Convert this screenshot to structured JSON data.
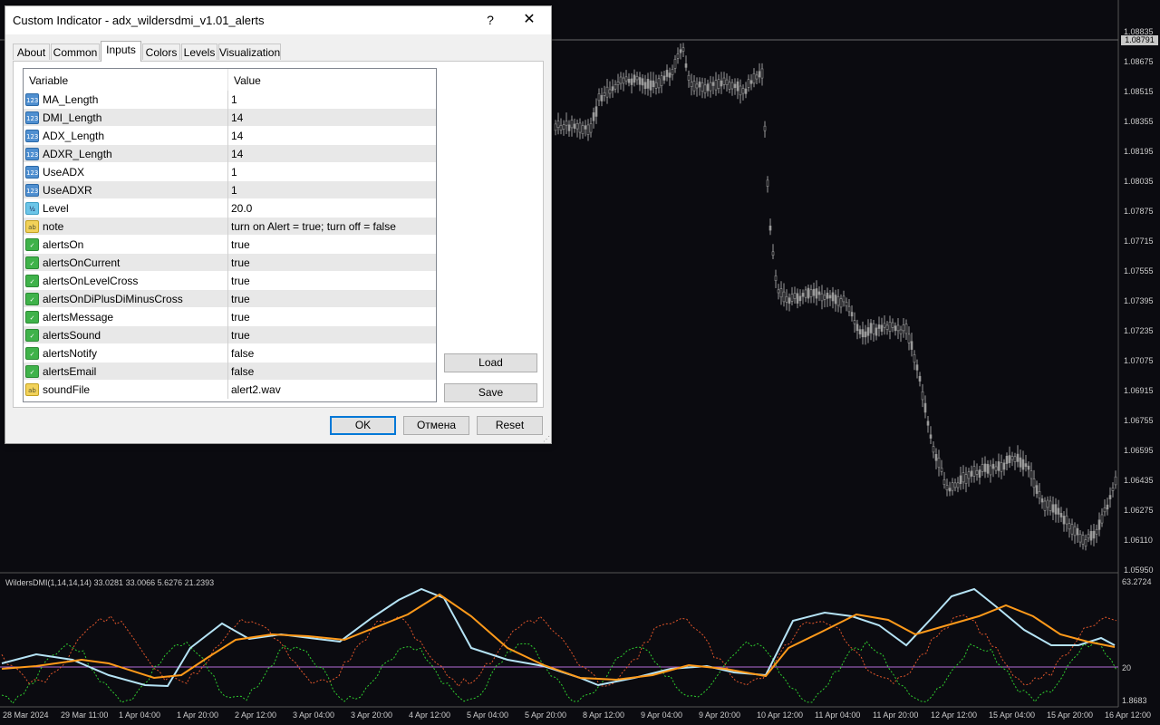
{
  "dialog": {
    "title": "Custom Indicator - adx_wildersdmi_v1.01_alerts",
    "help_glyph": "?",
    "close_glyph": "✕",
    "tabs": [
      "About",
      "Common",
      "Inputs",
      "Colors",
      "Levels",
      "Visualization"
    ],
    "active_tab": "Inputs",
    "grid": {
      "col_variable": "Variable",
      "col_value": "Value",
      "rows": [
        {
          "type": "int",
          "icon": "123",
          "name": "MA_Length",
          "value": "1"
        },
        {
          "type": "int",
          "icon": "123",
          "name": "DMI_Length",
          "value": "14"
        },
        {
          "type": "int",
          "icon": "123",
          "name": "ADX_Length",
          "value": "14"
        },
        {
          "type": "int",
          "icon": "123",
          "name": "ADXR_Length",
          "value": "14"
        },
        {
          "type": "int",
          "icon": "123",
          "name": "UseADX",
          "value": "1"
        },
        {
          "type": "int",
          "icon": "123",
          "name": "UseADXR",
          "value": "1"
        },
        {
          "type": "dbl",
          "icon": "½",
          "name": "Level",
          "value": "20.0"
        },
        {
          "type": "str",
          "icon": "ab",
          "name": "note",
          "value": "turn on Alert = true; turn off = false"
        },
        {
          "type": "bool",
          "icon": "✓",
          "name": "alertsOn",
          "value": "true"
        },
        {
          "type": "bool",
          "icon": "✓",
          "name": "alertsOnCurrent",
          "value": "true"
        },
        {
          "type": "bool",
          "icon": "✓",
          "name": "alertsOnLevelCross",
          "value": "true"
        },
        {
          "type": "bool",
          "icon": "✓",
          "name": "alertsOnDiPlusDiMinusCross",
          "value": "true"
        },
        {
          "type": "bool",
          "icon": "✓",
          "name": "alertsMessage",
          "value": "true"
        },
        {
          "type": "bool",
          "icon": "✓",
          "name": "alertsSound",
          "value": "true"
        },
        {
          "type": "bool",
          "icon": "✓",
          "name": "alertsNotify",
          "value": "false"
        },
        {
          "type": "bool",
          "icon": "✓",
          "name": "alertsEmail",
          "value": "false"
        },
        {
          "type": "str",
          "icon": "ab",
          "name": "soundFile",
          "value": "alert2.wav"
        }
      ]
    },
    "buttons": {
      "load": "Load",
      "save": "Save",
      "ok": "OK",
      "cancel": "Отмена",
      "reset": "Reset"
    }
  },
  "chart": {
    "price_labels": [
      "1.08835",
      "1.08675",
      "1.08515",
      "1.08355",
      "1.08195",
      "1.08035",
      "1.07875",
      "1.07715",
      "1.07555",
      "1.07395",
      "1.07235",
      "1.07075",
      "1.06915",
      "1.06755",
      "1.06595",
      "1.06435",
      "1.06275",
      "1.06110",
      "1.05950"
    ],
    "current_price": "1.08791",
    "time_labels": [
      "28 Mar 2024",
      "29 Mar 11:00",
      "1 Apr 04:00",
      "1 Apr 20:00",
      "2 Apr 12:00",
      "3 Apr 04:00",
      "3 Apr 20:00",
      "4 Apr 12:00",
      "5 Apr 04:00",
      "5 Apr 20:00",
      "8 Apr 12:00",
      "9 Apr 04:00",
      "9 Apr 20:00",
      "10 Apr 12:00",
      "11 Apr 04:00",
      "11 Apr 20:00",
      "12 Apr 12:00",
      "15 Apr 04:00",
      "15 Apr 20:00",
      "16 Apr 12:00"
    ],
    "indicator": {
      "label": "WildersDMI(1,14,14,14) 33.0281 33.0066 5.6276 21.2393",
      "scale_top": "63.2724",
      "scale_level": "20",
      "scale_bottom": "1.8683"
    },
    "colors": {
      "background": "#0b0b10",
      "candles": "#9a9a9a",
      "adx": "#ff9a1a",
      "adxr": "#b5e3f5",
      "di_plus": "#2ecc2e",
      "di_minus": "#e0552a",
      "level": "#b36bd6"
    }
  }
}
